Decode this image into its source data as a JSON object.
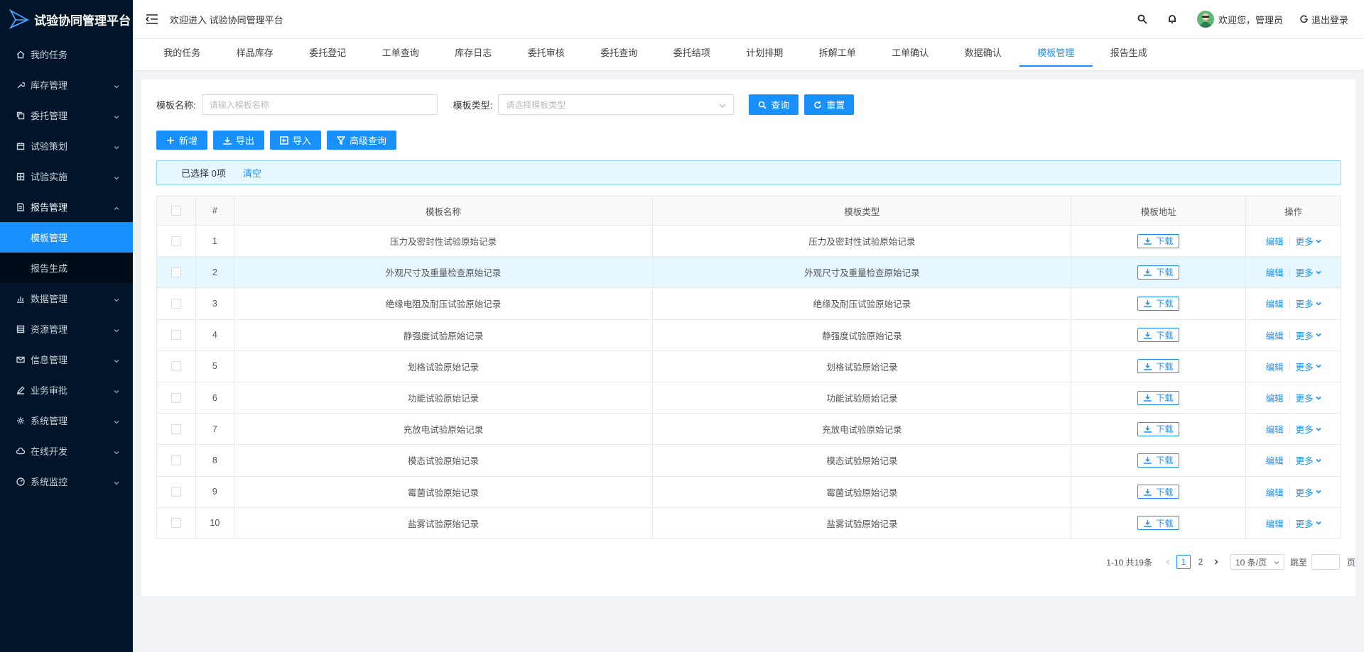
{
  "app": {
    "title": "试验协同管理平台",
    "welcome": "欢迎进入 试验协同管理平台"
  },
  "user": {
    "greeting": "欢迎您，管理员",
    "logout": "退出登录"
  },
  "sidebar": {
    "items": [
      {
        "label": "我的任务",
        "icon": "home-icon"
      },
      {
        "label": "库存管理",
        "icon": "wrench-icon"
      },
      {
        "label": "委托管理",
        "icon": "copy-icon"
      },
      {
        "label": "试验策划",
        "icon": "calendar-icon"
      },
      {
        "label": "试验实施",
        "icon": "grid-icon"
      },
      {
        "label": "报告管理",
        "icon": "report-icon"
      },
      {
        "label": "数据管理",
        "icon": "chart-icon"
      },
      {
        "label": "资源管理",
        "icon": "list-icon"
      },
      {
        "label": "信息管理",
        "icon": "mail-icon"
      },
      {
        "label": "业务审批",
        "icon": "edit-icon"
      },
      {
        "label": "系统管理",
        "icon": "gear-icon"
      },
      {
        "label": "在线开发",
        "icon": "cloud-icon"
      },
      {
        "label": "系统监控",
        "icon": "dashboard-icon"
      }
    ],
    "sub_items": [
      "模板管理",
      "报告生成"
    ]
  },
  "tabs": [
    "我的任务",
    "样品库存",
    "委托登记",
    "工单查询",
    "库存日志",
    "委托审核",
    "委托查询",
    "委托结项",
    "计划排期",
    "拆解工单",
    "工单确认",
    "数据确认",
    "模板管理",
    "报告生成"
  ],
  "search": {
    "name_label": "模板名称:",
    "name_placeholder": "请输入模板名称",
    "type_label": "模板类型:",
    "type_placeholder": "请选择模板类型",
    "query": "查询",
    "reset": "重置"
  },
  "toolbar": {
    "add": "新增",
    "export": "导出",
    "import": "导入",
    "advanced": "高级查询"
  },
  "selection": {
    "text": "已选择 0项",
    "clear": "清空"
  },
  "table": {
    "headers": {
      "idx": "#",
      "name": "模板名称",
      "type": "模板类型",
      "addr": "模板地址",
      "op": "操作"
    },
    "download": "下载",
    "edit": "编辑",
    "more": "更多",
    "rows": [
      {
        "idx": "1",
        "name": "压力及密封性试验原始记录",
        "type": "压力及密封性试验原始记录"
      },
      {
        "idx": "2",
        "name": "外观尺寸及重量检查原始记录",
        "type": "外观尺寸及重量检查原始记录"
      },
      {
        "idx": "3",
        "name": "绝缘电阻及耐压试验原始记录",
        "type": "绝缘及耐压试验原始记录"
      },
      {
        "idx": "4",
        "name": "静强度试验原始记录",
        "type": "静强度试验原始记录"
      },
      {
        "idx": "5",
        "name": "划格试验原始记录",
        "type": "划格试验原始记录"
      },
      {
        "idx": "6",
        "name": "功能试验原始记录",
        "type": "功能试验原始记录"
      },
      {
        "idx": "7",
        "name": "充放电试验原始记录",
        "type": "充放电试验原始记录"
      },
      {
        "idx": "8",
        "name": "模态试验原始记录",
        "type": "模态试验原始记录"
      },
      {
        "idx": "9",
        "name": "霉菌试验原始记录",
        "type": "霉菌试验原始记录"
      },
      {
        "idx": "10",
        "name": "盐雾试验原始记录",
        "type": "盐雾试验原始记录"
      }
    ]
  },
  "pagination": {
    "total": "1-10 共19条",
    "pages": [
      "1",
      "2"
    ],
    "size": "10 条/页",
    "jump": "跳至",
    "page_unit": "页"
  },
  "colors": {
    "accent": "#1890ff",
    "sidebar": "#001529"
  }
}
